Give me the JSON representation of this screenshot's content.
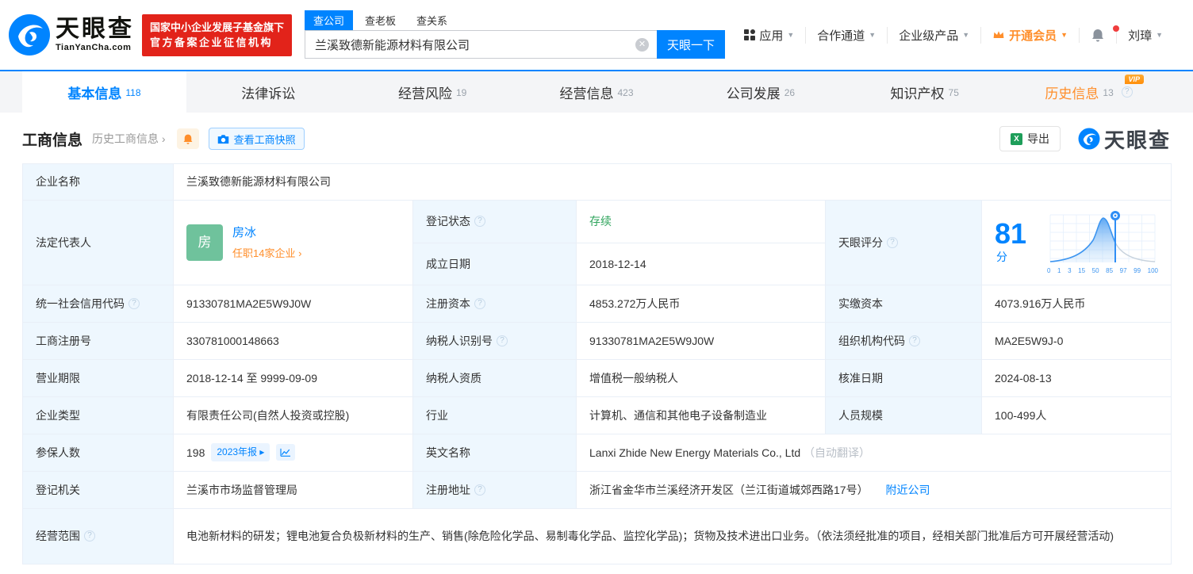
{
  "colors": {
    "brand_blue": "#0084ff",
    "accent_orange": "#ff8e2a",
    "status_green": "#2fa45c",
    "badge_red": "#e2231a",
    "avatar_green": "#6fc29c"
  },
  "header": {
    "logo_title": "天眼查",
    "logo_subtitle": "TianYanCha.com",
    "badge_line1": "国家中小企业发展子基金旗下",
    "badge_line2": "官方备案企业征信机构",
    "search_tabs": {
      "company": "查公司",
      "boss": "查老板",
      "relation": "查关系"
    },
    "search_value": "兰溪致德新能源材料有限公司",
    "search_button": "天眼一下",
    "nav": {
      "apps": "应用",
      "partner": "合作通道",
      "enterprise": "企业级产品",
      "vip": "开通会员",
      "user": "刘璋"
    }
  },
  "tabs": [
    {
      "label": "基本信息",
      "count": "118"
    },
    {
      "label": "法律诉讼",
      "count": ""
    },
    {
      "label": "经营风险",
      "count": "19"
    },
    {
      "label": "经营信息",
      "count": "423"
    },
    {
      "label": "公司发展",
      "count": "26"
    },
    {
      "label": "知识产权",
      "count": "75"
    },
    {
      "label": "历史信息",
      "count": "13",
      "vip": "VIP"
    }
  ],
  "section": {
    "title": "工商信息",
    "history_link": "历史工商信息 ›",
    "snapshot_button": "查看工商快照",
    "export_button": "导出",
    "watermark": "天眼查"
  },
  "fields": {
    "company_name": {
      "label": "企业名称",
      "value": "兰溪致德新能源材料有限公司"
    },
    "legal_rep": {
      "label": "法定代表人",
      "avatar_char": "房",
      "name": "房冰",
      "positions_link": "任职14家企业 ›"
    },
    "reg_status": {
      "label": "登记状态",
      "value": "存续"
    },
    "establish_date": {
      "label": "成立日期",
      "value": "2018-12-14"
    },
    "credit_code": {
      "label": "统一社会信用代码",
      "value": "91330781MA2E5W9J0W"
    },
    "reg_capital": {
      "label": "注册资本",
      "value": "4853.272万人民币"
    },
    "paid_capital": {
      "label": "实缴资本",
      "value": "4073.916万人民币"
    },
    "reg_number": {
      "label": "工商注册号",
      "value": "330781000148663"
    },
    "taxpayer_id": {
      "label": "纳税人识别号",
      "value": "91330781MA2E5W9J0W"
    },
    "org_code": {
      "label": "组织机构代码",
      "value": "MA2E5W9J-0"
    },
    "business_term": {
      "label": "营业期限",
      "value": "2018-12-14 至 9999-09-09"
    },
    "taxpayer_quals": {
      "label": "纳税人资质",
      "value": "增值税一般纳税人"
    },
    "approval_date": {
      "label": "核准日期",
      "value": "2024-08-13"
    },
    "company_type": {
      "label": "企业类型",
      "value": "有限责任公司(自然人投资或控股)"
    },
    "industry": {
      "label": "行业",
      "value": "计算机、通信和其他电子设备制造业"
    },
    "staff_size": {
      "label": "人员规模",
      "value": "100-499人"
    },
    "insured_count": {
      "label": "参保人数",
      "value": "198",
      "report_badge": "2023年报 ▸"
    },
    "english_name": {
      "label": "英文名称",
      "value": "Lanxi Zhide New Energy Materials Co., Ltd",
      "note": "（自动翻译）"
    },
    "reg_authority": {
      "label": "登记机关",
      "value": "兰溪市市场监督管理局"
    },
    "reg_address": {
      "label": "注册地址",
      "value": "浙江省金华市兰溪经济开发区（兰江街道城郊西路17号）",
      "nearby_link": "附近公司"
    },
    "business_scope": {
      "label": "经营范围",
      "value": "电池新材料的研发；锂电池复合负极新材料的生产、销售(除危险化学品、易制毒化学品、监控化学品)；货物及技术进出口业务。（依法须经批准的项目，经相关部门批准后方可开展经营活动)"
    }
  },
  "score": {
    "label": "天眼评分",
    "value": "81",
    "unit": "分",
    "axis": [
      "0",
      "1",
      "3",
      "15",
      "50",
      "85",
      "97",
      "99",
      "100"
    ]
  },
  "chart_data": {
    "type": "area",
    "title": "天眼评分分布曲线",
    "x_tick_labels": [
      "0",
      "1",
      "3",
      "15",
      "50",
      "85",
      "97",
      "99",
      "100"
    ],
    "marker_value": 81,
    "marker_axis_position": "85",
    "legend_position": "none",
    "grid": true
  }
}
